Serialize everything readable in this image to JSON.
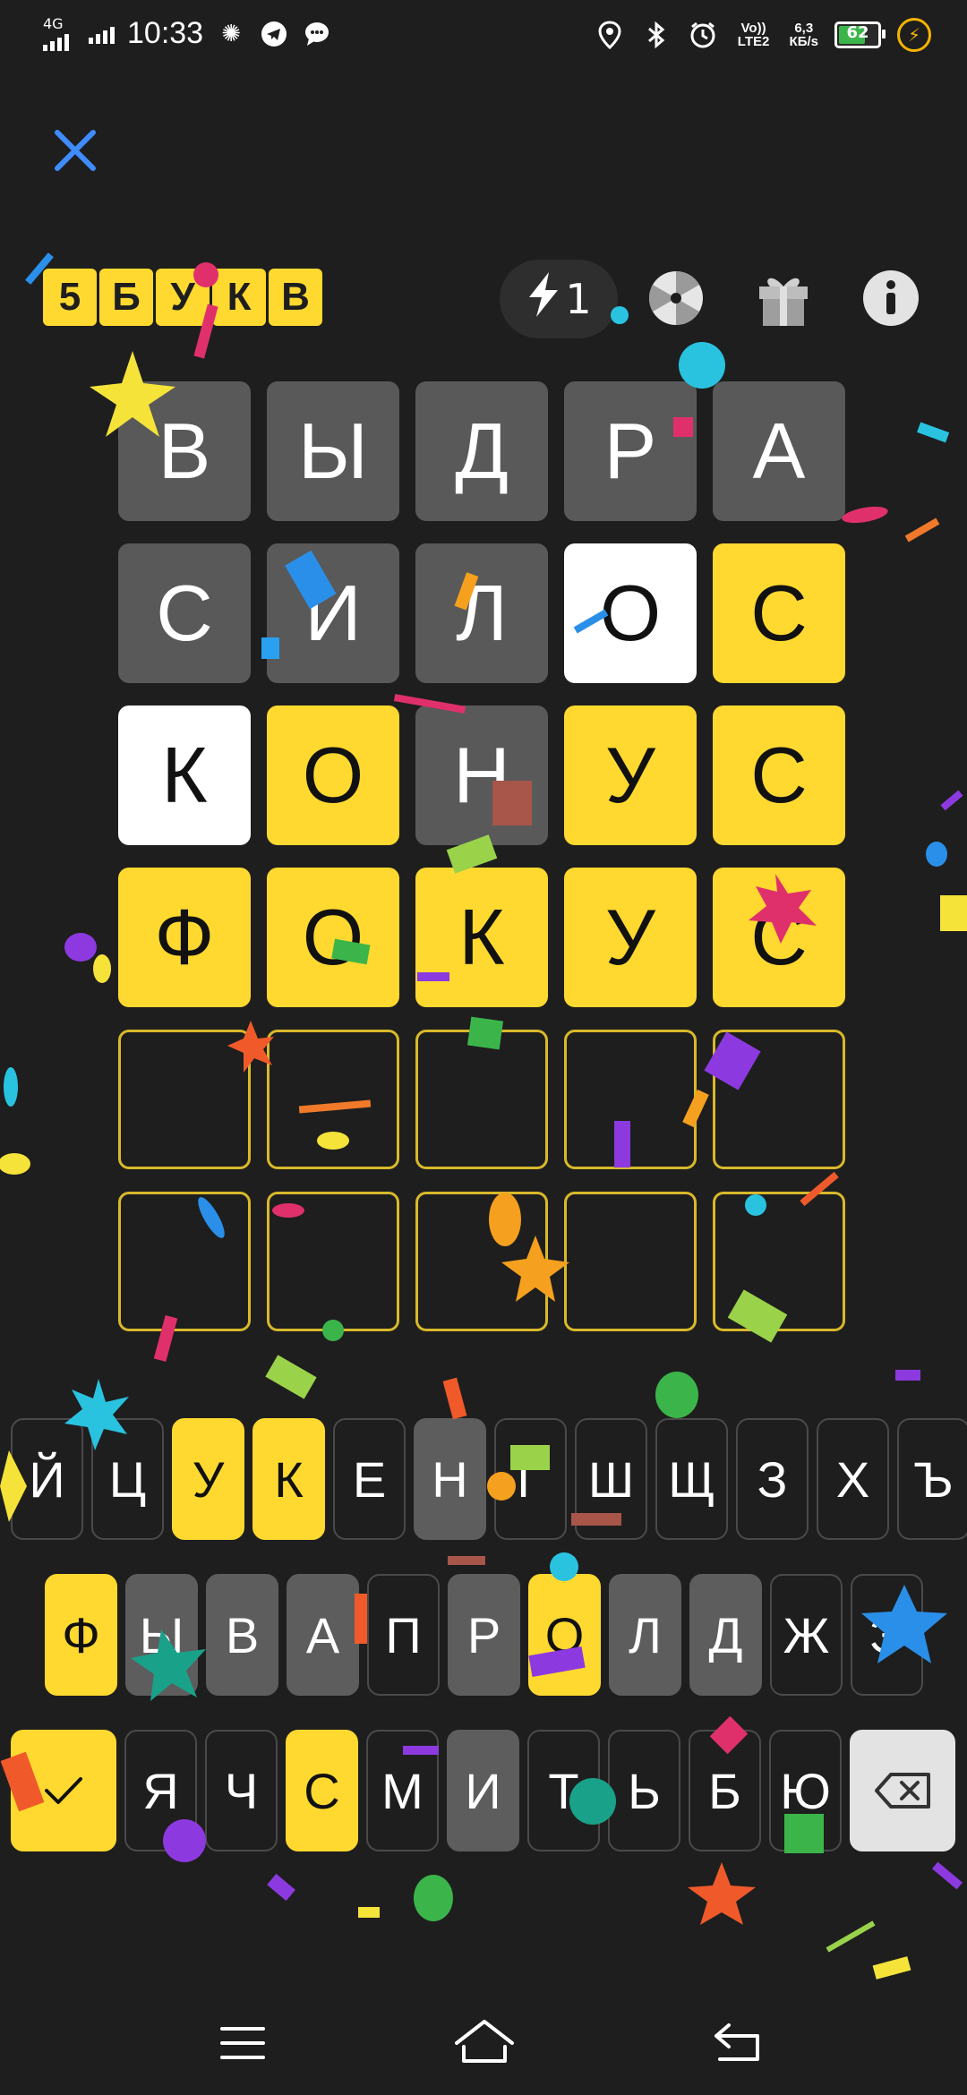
{
  "status_bar": {
    "network": "4G",
    "time": "10:33",
    "volte": "Vo)) LTE2",
    "speed_value": "6,3",
    "speed_unit": "КБ/s",
    "battery_level": "62",
    "icons": [
      "signal-icon",
      "signal-icon",
      "sparkle-icon",
      "telegram-icon",
      "chat-icon",
      "location-icon",
      "bluetooth-icon",
      "alarm-icon",
      "charging-icon"
    ]
  },
  "header": {
    "logo_letters": [
      "5",
      "Б",
      "У",
      "К",
      "В"
    ],
    "boost_count": "1",
    "icons": [
      "close-icon",
      "lightning-icon",
      "wheel-icon",
      "gift-icon",
      "info-icon"
    ]
  },
  "grid": {
    "rows": [
      [
        {
          "letter": "В",
          "state": "gray"
        },
        {
          "letter": "Ы",
          "state": "gray"
        },
        {
          "letter": "Д",
          "state": "gray"
        },
        {
          "letter": "Р",
          "state": "gray"
        },
        {
          "letter": "А",
          "state": "gray"
        }
      ],
      [
        {
          "letter": "С",
          "state": "gray"
        },
        {
          "letter": "И",
          "state": "gray"
        },
        {
          "letter": "Л",
          "state": "gray"
        },
        {
          "letter": "О",
          "state": "white"
        },
        {
          "letter": "С",
          "state": "yellow"
        }
      ],
      [
        {
          "letter": "К",
          "state": "white"
        },
        {
          "letter": "О",
          "state": "yellow"
        },
        {
          "letter": "Н",
          "state": "gray"
        },
        {
          "letter": "У",
          "state": "yellow"
        },
        {
          "letter": "С",
          "state": "yellow"
        }
      ],
      [
        {
          "letter": "Ф",
          "state": "yellow"
        },
        {
          "letter": "О",
          "state": "yellow"
        },
        {
          "letter": "К",
          "state": "yellow"
        },
        {
          "letter": "У",
          "state": "yellow"
        },
        {
          "letter": "С",
          "state": "yellow"
        }
      ],
      [
        {
          "letter": "",
          "state": "empty"
        },
        {
          "letter": "",
          "state": "empty"
        },
        {
          "letter": "",
          "state": "empty"
        },
        {
          "letter": "",
          "state": "empty"
        },
        {
          "letter": "",
          "state": "empty"
        }
      ],
      [
        {
          "letter": "",
          "state": "empty"
        },
        {
          "letter": "",
          "state": "empty"
        },
        {
          "letter": "",
          "state": "empty"
        },
        {
          "letter": "",
          "state": "empty"
        },
        {
          "letter": "",
          "state": "empty"
        }
      ]
    ]
  },
  "keyboard": {
    "row1": [
      {
        "label": "Й",
        "state": "none"
      },
      {
        "label": "Ц",
        "state": "none"
      },
      {
        "label": "У",
        "state": "yellow"
      },
      {
        "label": "К",
        "state": "yellow"
      },
      {
        "label": "Е",
        "state": "none"
      },
      {
        "label": "Н",
        "state": "gray"
      },
      {
        "label": "Г",
        "state": "none"
      },
      {
        "label": "Ш",
        "state": "none"
      },
      {
        "label": "Щ",
        "state": "none"
      },
      {
        "label": "З",
        "state": "none"
      },
      {
        "label": "Х",
        "state": "none"
      },
      {
        "label": "Ъ",
        "state": "none"
      }
    ],
    "row2": [
      {
        "label": "Ф",
        "state": "yellow"
      },
      {
        "label": "Ы",
        "state": "gray"
      },
      {
        "label": "В",
        "state": "gray"
      },
      {
        "label": "А",
        "state": "gray"
      },
      {
        "label": "П",
        "state": "none"
      },
      {
        "label": "Р",
        "state": "gray"
      },
      {
        "label": "О",
        "state": "yellow"
      },
      {
        "label": "Л",
        "state": "gray"
      },
      {
        "label": "Д",
        "state": "gray"
      },
      {
        "label": "Ж",
        "state": "none"
      },
      {
        "label": "Э",
        "state": "none"
      }
    ],
    "row3": [
      {
        "label": "Я",
        "state": "none"
      },
      {
        "label": "Ч",
        "state": "none"
      },
      {
        "label": "С",
        "state": "yellow"
      },
      {
        "label": "М",
        "state": "none"
      },
      {
        "label": "И",
        "state": "gray"
      },
      {
        "label": "Т",
        "state": "none"
      },
      {
        "label": "Ь",
        "state": "none"
      },
      {
        "label": "Б",
        "state": "none"
      },
      {
        "label": "Ю",
        "state": "none"
      }
    ],
    "enter_icon": "check-icon",
    "backspace_icon": "backspace-icon"
  },
  "nav_bar": {
    "icons": [
      "menu-icon",
      "home-icon",
      "back-icon"
    ]
  },
  "colors": {
    "background": "#1e1e1e",
    "tile_gray": "#595959",
    "tile_yellow": "#ffd92f",
    "tile_white": "#ffffff",
    "empty_border": "#d9b92a"
  }
}
